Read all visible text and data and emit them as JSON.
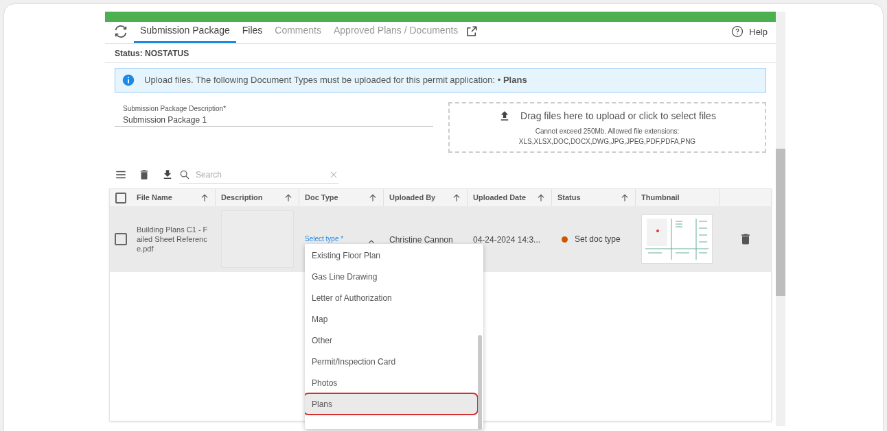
{
  "tabs": [
    {
      "label": "Submission Package",
      "selected": true,
      "disabled": false
    },
    {
      "label": "Files",
      "selected": false,
      "disabled": false
    },
    {
      "label": "Comments",
      "selected": false,
      "disabled": true
    },
    {
      "label": "Approved Plans / Documents",
      "selected": false,
      "disabled": true
    }
  ],
  "help": "Help",
  "status": "Status: NOSTATUS",
  "info_banner": "Upload files. The following Document Types must be uploaded for this permit application: • **Plans**",
  "description_field": {
    "label": "Submission Package Description*",
    "value": "Submission Package 1"
  },
  "upload_area": {
    "title": "Drag files here to upload or click to select files",
    "note": "Cannot exceed 250Mb. Allowed file extensions:",
    "extensions": "XLS,XLSX,DOC,DOCX,DWG,JPG,JPEG,PDF,PDFA,PNG"
  },
  "search": {
    "placeholder": "Search"
  },
  "table": {
    "columns": [
      "File Name",
      "Description",
      "Doc Type",
      "Uploaded By",
      "Uploaded Date",
      "Status",
      "Thumbnail"
    ],
    "select_all_checked": false,
    "rows": [
      {
        "checked": false,
        "file_name": "Building Plans C1 - Failed Sheet Reference.pdf",
        "doc_type_label": "Select type *",
        "uploaded_by": "Christine Cannon",
        "uploaded_date": "04-24-2024 14:3...",
        "status": "Set doc type",
        "color": "#d35400"
      }
    ]
  },
  "dropdown": {
    "items": [
      {
        "label": "Existing Floor Plan",
        "selected": false
      },
      {
        "label": "Gas Line Drawing",
        "selected": false
      },
      {
        "label": "Letter of Authorization",
        "selected": false
      },
      {
        "label": "Map",
        "selected": false
      },
      {
        "label": "Other",
        "selected": false
      },
      {
        "label": "Permit/Inspection Card",
        "selected": false
      },
      {
        "label": "Photos",
        "selected": false
      },
      {
        "label": "Plans",
        "selected": true
      }
    ]
  }
}
